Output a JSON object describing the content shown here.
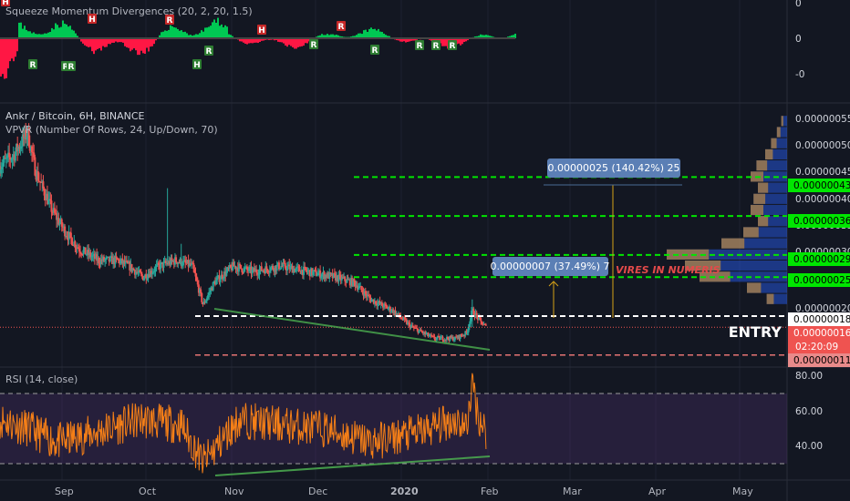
{
  "colors": {
    "background": "#131722",
    "candle_up": "#26a69a",
    "candle_down": "#ef5350",
    "level_green": "#00e600",
    "rsi_line": "#f57f17",
    "rsi_band": "#4a2e6b",
    "trend_line": "#4caf50",
    "text": "#d1d4dc"
  },
  "squeeze_panel": {
    "title": "Squeeze Momentum Divergences (20, 2, 20, 1.5)",
    "axis_ticks": [
      "0",
      "0",
      "-0"
    ],
    "marker_labels": [
      "H",
      "R",
      "H",
      "R",
      "R",
      "H",
      "R",
      "H",
      "R",
      "R",
      "R",
      "R",
      "R",
      "R",
      "R"
    ]
  },
  "main_panel": {
    "title": "Ankr / Bitcoin, 6H, BINANCE",
    "indicator": "VPVR (Number Of Rows, 24, Up/Down, 70)",
    "axis_ticks": [
      "0.00000055",
      "0.00000050",
      "0.00000045",
      "0.00000040",
      "0.00000035",
      "0.00000030",
      "0.00000020"
    ],
    "level_labels": {
      "l43": "0.00000043",
      "l36": "0.00000036",
      "l29": "0.00000029",
      "l25": "0.00000025",
      "l18": "0.00000018",
      "l16": "0.00000016",
      "countdown": "02:20:09",
      "l11": "0.00000011"
    },
    "entry_label": "ENTRY",
    "watermark": "VIRES IN NUMERIS",
    "measure_big": "0.00000025 (140.42%) 25",
    "measure_small": "0.00000007 (37.49%) 7"
  },
  "rsi_panel": {
    "title": "RSI (14, close)",
    "axis_ticks": [
      "80.00",
      "60.00",
      "40.00"
    ]
  },
  "time_axis": [
    "Sep",
    "Oct",
    "Nov",
    "Dec",
    "2020",
    "Feb",
    "Mar",
    "Apr",
    "May"
  ],
  "chart_data": {
    "type": "candlestick",
    "title": "Ankr / Bitcoin, 6H, BINANCE",
    "x_range": [
      "2019-08-15",
      "2020-05-25"
    ],
    "price_range": [
      9e-08,
      5.6e-07
    ],
    "close_path": [
      [
        "2019-08-15",
        4.5e-07
      ],
      [
        "2019-08-20",
        4.7e-07
      ],
      [
        "2019-08-25",
        5.1e-07
      ],
      [
        "2019-08-28",
        4.4e-07
      ],
      [
        "2019-09-03",
        3.7e-07
      ],
      [
        "2019-09-08",
        3.3e-07
      ],
      [
        "2019-09-13",
        3e-07
      ],
      [
        "2019-09-20",
        2.8e-07
      ],
      [
        "2019-09-27",
        2.8e-07
      ],
      [
        "2019-10-01",
        2.7e-07
      ],
      [
        "2019-10-06",
        2.5e-07
      ],
      [
        "2019-10-12",
        2.7e-07
      ],
      [
        "2019-10-18",
        2.8e-07
      ],
      [
        "2019-10-24",
        2.7e-07
      ],
      [
        "2019-10-28",
        2e-07
      ],
      [
        "2019-11-01",
        2.4e-07
      ],
      [
        "2019-11-08",
        2.7e-07
      ],
      [
        "2019-11-15",
        2.6e-07
      ],
      [
        "2019-11-25",
        2.7e-07
      ],
      [
        "2019-12-05",
        2.6e-07
      ],
      [
        "2019-12-15",
        2.5e-07
      ],
      [
        "2019-12-22",
        2.4e-07
      ],
      [
        "2019-12-28",
        2.1e-07
      ],
      [
        "2020-01-05",
        1.9e-07
      ],
      [
        "2020-01-12",
        1.6e-07
      ],
      [
        "2020-01-20",
        1.4e-07
      ],
      [
        "2020-01-28",
        1.4e-07
      ],
      [
        "2020-02-01",
        1.5e-07
      ],
      [
        "2020-02-03",
        1.9e-07
      ],
      [
        "2020-02-06",
        1.7e-07
      ],
      [
        "2020-02-08",
        1.6e-07
      ]
    ],
    "horizontal_levels": [
      {
        "value": 4.3e-07,
        "style": "green-dashed"
      },
      {
        "value": 3.6e-07,
        "style": "green-dashed"
      },
      {
        "value": 2.9e-07,
        "style": "green-dashed"
      },
      {
        "value": 2.5e-07,
        "style": "green-dashed"
      },
      {
        "value": 1.8e-07,
        "style": "white-dashed"
      },
      {
        "value": 1.1e-07,
        "style": "red-dashed"
      }
    ],
    "current_price": 1.6e-07,
    "rsi": {
      "range": [
        20,
        85
      ],
      "bands": [
        70,
        30
      ],
      "path": [
        [
          "2019-08-15",
          55
        ],
        [
          "2019-08-25",
          50
        ],
        [
          "2019-09-05",
          42
        ],
        [
          "2019-09-20",
          48
        ],
        [
          "2019-10-05",
          55
        ],
        [
          "2019-10-20",
          52
        ],
        [
          "2019-10-28",
          30
        ],
        [
          "2019-11-10",
          55
        ],
        [
          "2019-11-25",
          52
        ],
        [
          "2019-12-10",
          50
        ],
        [
          "2019-12-28",
          42
        ],
        [
          "2020-01-15",
          48
        ],
        [
          "2020-01-28",
          55
        ],
        [
          "2020-02-01",
          50
        ],
        [
          "2020-02-03",
          78
        ],
        [
          "2020-02-05",
          58
        ],
        [
          "2020-02-08",
          48
        ]
      ]
    }
  }
}
